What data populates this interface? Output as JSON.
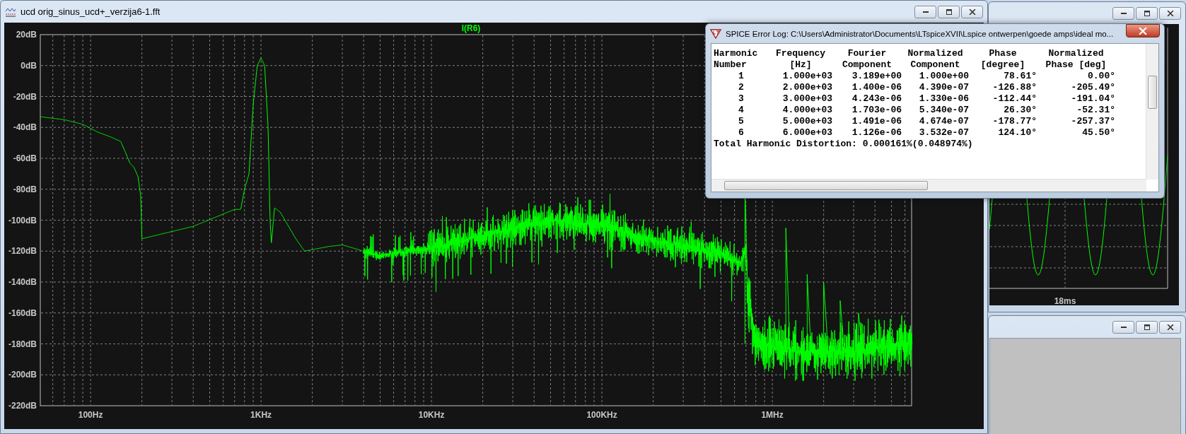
{
  "main_window": {
    "title": "ucd orig_sinus_ucd+_verzija6-1.fft",
    "trace_label": "I(R6)",
    "y_axis_labels": [
      "20dB",
      "0dB",
      "-20dB",
      "-40dB",
      "-60dB",
      "-80dB",
      "-100dB",
      "-120dB",
      "-140dB",
      "-160dB",
      "-180dB",
      "-200dB",
      "-220dB"
    ],
    "x_axis_labels": [
      "100Hz",
      "1KHz",
      "10KHz",
      "100KHz",
      "1MHz"
    ]
  },
  "error_log": {
    "title": "SPICE Error Log: C:\\Users\\Administrator\\Documents\\LTspiceXVII\\Lspice ontwerpen\\goede amps\\ideal mo...",
    "header": [
      [
        "Harmonic",
        "Number"
      ],
      [
        "Frequency",
        "[Hz]"
      ],
      [
        "Fourier",
        "Component"
      ],
      [
        "Normalized",
        "Component"
      ],
      [
        "Phase",
        "[degree]"
      ],
      [
        "Normalized",
        "Phase [deg]"
      ]
    ],
    "rows": [
      [
        "1",
        "1.000e+03",
        "3.189e+00",
        "1.000e+00",
        "78.61°",
        "0.00°"
      ],
      [
        "2",
        "2.000e+03",
        "1.400e-06",
        "4.390e-07",
        "-126.88°",
        "-205.49°"
      ],
      [
        "3",
        "3.000e+03",
        "4.243e-06",
        "1.330e-06",
        "-112.44°",
        "-191.04°"
      ],
      [
        "4",
        "4.000e+03",
        "1.703e-06",
        "5.340e-07",
        "26.30°",
        "-52.31°"
      ],
      [
        "5",
        "5.000e+03",
        "1.491e-06",
        "4.674e-07",
        "-178.77°",
        "-257.37°"
      ],
      [
        "6",
        "6.000e+03",
        "1.126e-06",
        "3.532e-07",
        "124.10°",
        "45.50°"
      ]
    ],
    "summary": "Total Harmonic Distortion: 0.000161%(0.048974%)"
  },
  "waveform_window": {
    "x_axis_label": "18ms"
  }
}
